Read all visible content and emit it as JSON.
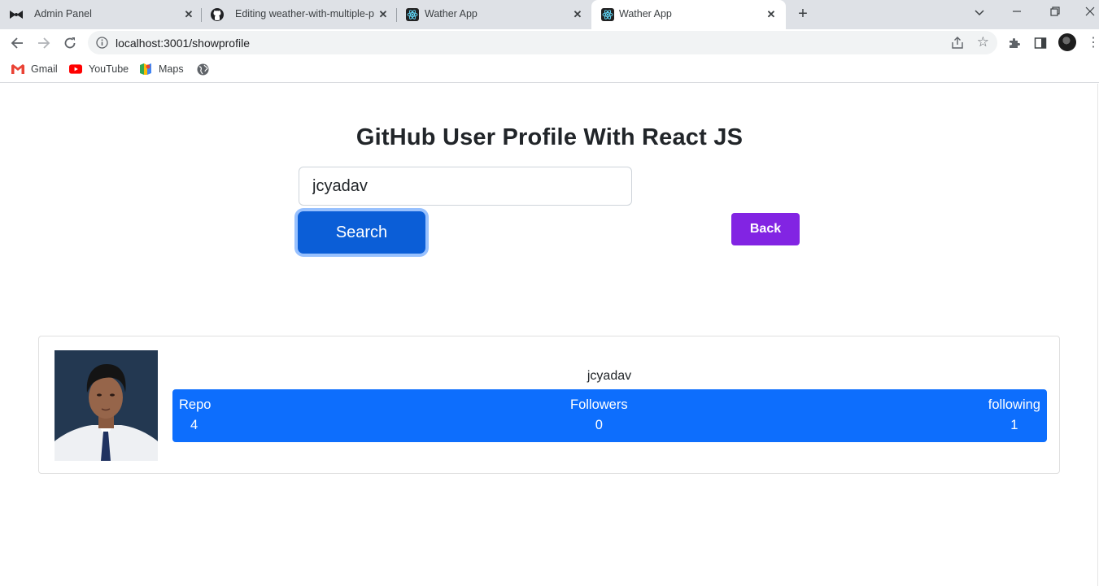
{
  "browser": {
    "tabs": [
      {
        "title": "Admin Panel",
        "icon": "bowtie-icon",
        "active": false
      },
      {
        "title": "Editing weather-with-multiple-p",
        "icon": "github-icon",
        "active": false
      },
      {
        "title": "Wather App",
        "icon": "react-icon",
        "active": false
      },
      {
        "title": "Wather App",
        "icon": "react-icon",
        "active": true
      }
    ],
    "url": "localhost:3001/showprofile",
    "bookmarks": [
      {
        "label": "Gmail",
        "icon": "gmail-icon"
      },
      {
        "label": "YouTube",
        "icon": "youtube-icon"
      },
      {
        "label": "Maps",
        "icon": "maps-icon"
      }
    ]
  },
  "page": {
    "heading": "GitHub User Profile With React JS",
    "search": {
      "value": "jcyadav",
      "button_label": "Search"
    },
    "back_label": "Back",
    "profile": {
      "username": "jcyadav",
      "stats": [
        {
          "label": "Repo",
          "value": "4"
        },
        {
          "label": "Followers",
          "value": "0"
        },
        {
          "label": "following",
          "value": "1"
        }
      ]
    }
  },
  "colors": {
    "search_button": "#0b5ed7",
    "back_button": "#8224e3",
    "stats_bar": "#0d6efd"
  }
}
